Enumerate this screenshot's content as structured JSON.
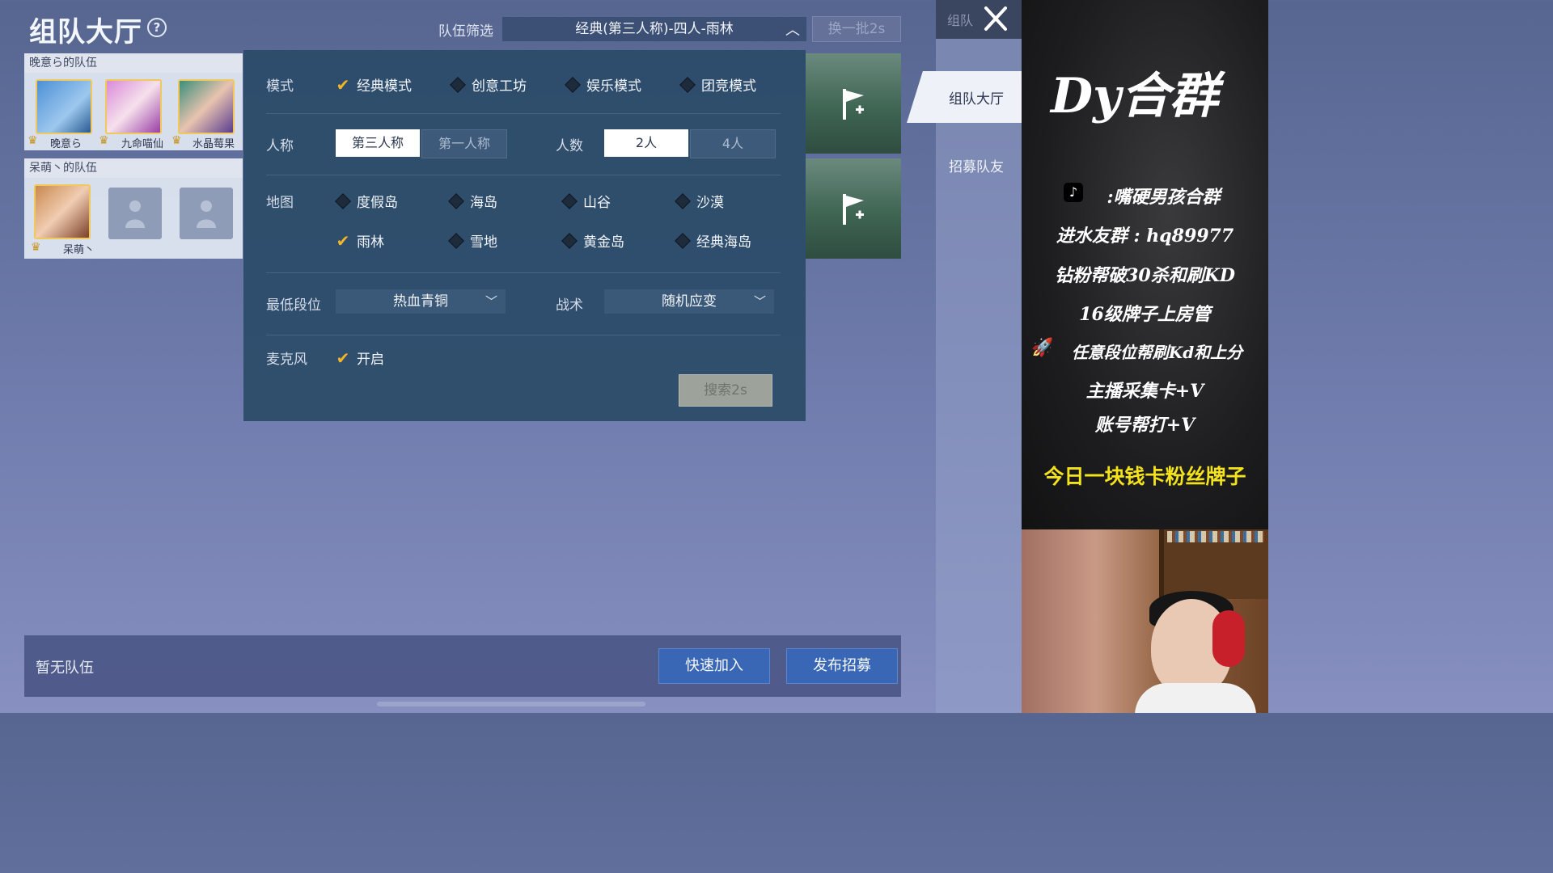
{
  "header": {
    "title": "组队大厅",
    "help_glyph": "?",
    "filter_label": "队伍筛选",
    "filter_value": "经典(第三人称)-四人-雨林",
    "refresh_label": "换一批2s"
  },
  "teams": [
    {
      "header": "晚意ら的队伍",
      "members": [
        "晚意ら",
        "九命喵仙",
        "水晶莓果"
      ]
    },
    {
      "header": "呆萌丶的队伍",
      "members": [
        "呆萌丶"
      ]
    }
  ],
  "filter_panel": {
    "mode": {
      "label": "模式",
      "options": [
        {
          "label": "经典模式",
          "checked": true
        },
        {
          "label": "创意工坊",
          "checked": false
        },
        {
          "label": "娱乐模式",
          "checked": false
        },
        {
          "label": "团竞模式",
          "checked": false
        }
      ]
    },
    "perspective": {
      "label": "人称",
      "options": [
        {
          "label": "第三人称",
          "selected": true
        },
        {
          "label": "第一人称",
          "selected": false
        }
      ]
    },
    "count": {
      "label": "人数",
      "options": [
        {
          "label": "2人",
          "selected": true
        },
        {
          "label": "4人",
          "selected": false
        }
      ]
    },
    "map": {
      "label": "地图",
      "options": [
        {
          "label": "度假岛",
          "checked": false
        },
        {
          "label": "海岛",
          "checked": false
        },
        {
          "label": "山谷",
          "checked": false
        },
        {
          "label": "沙漠",
          "checked": false
        },
        {
          "label": "雨林",
          "checked": true
        },
        {
          "label": "雪地",
          "checked": false
        },
        {
          "label": "黄金岛",
          "checked": false
        },
        {
          "label": "经典海岛",
          "checked": false
        }
      ]
    },
    "min_rank": {
      "label": "最低段位",
      "value": "热血青铜"
    },
    "tactic": {
      "label": "战术",
      "value": "随机应变"
    },
    "mic": {
      "label": "麦克风",
      "option": "开启",
      "checked": true
    },
    "search_label": "搜索2s"
  },
  "bottom": {
    "no_team": "暂无队伍",
    "quick_join": "快速加入",
    "post_recruit": "发布招募"
  },
  "sidebar": {
    "top_label": "组队",
    "items": [
      {
        "label": "组队大厅",
        "active": true
      },
      {
        "label": "招募队友",
        "active": false
      }
    ]
  },
  "stream_overlay": {
    "title": "Dy合群",
    "lines": [
      ":嘴硬男孩合群",
      "进水友群 : hq89977",
      "钻粉帮破30杀和刷KD",
      "16级牌子上房管",
      "任意段位帮刷Kd和上分",
      "主播采集卡+V",
      "账号帮打+V"
    ],
    "banner": "今日一块钱卡粉丝牌子"
  },
  "colors": {
    "accent_check": "#f5b525",
    "primary_button": "#3a67b5",
    "banner_yellow": "#f3e21c"
  }
}
